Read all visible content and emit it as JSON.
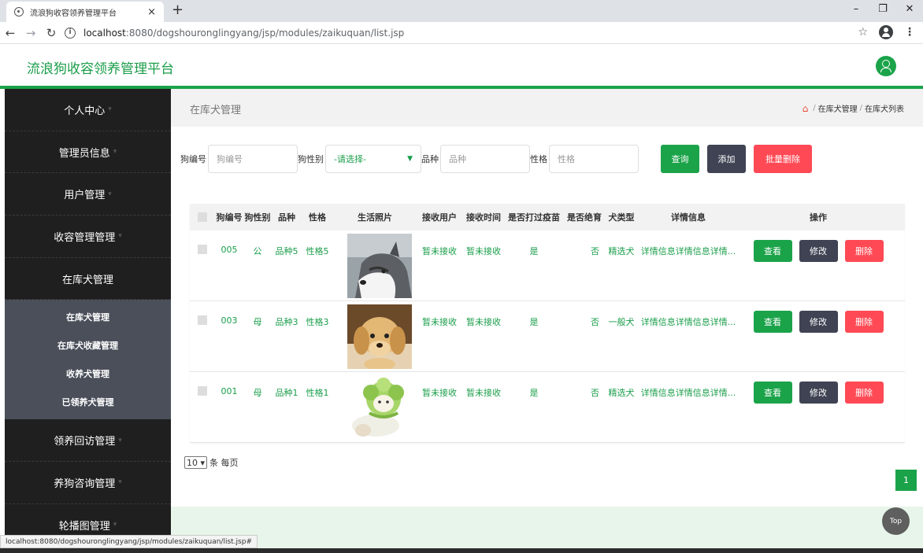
{
  "browser": {
    "tab_title": "流浪狗收容领养管理平台",
    "tab_close": "×",
    "new_tab": "+",
    "window_buttons": [
      "–",
      "❐",
      "✕"
    ],
    "url_host": "localhost",
    "url_path": ":8080/dogshouronglingyang/jsp/modules/zaikuquan/list.jsp",
    "status_url": "localhost:8080/dogshouronglingyang/jsp/modules/zaikuquan/list.jsp#"
  },
  "header": {
    "title": "流浪狗收容领养管理平台"
  },
  "sidebar": {
    "items": [
      {
        "label": "个人中心"
      },
      {
        "label": "管理员信息"
      },
      {
        "label": "用户管理"
      },
      {
        "label": "收容管理管理"
      },
      {
        "label": "在库犬管理"
      }
    ],
    "subitems": [
      {
        "label": "在库犬管理"
      },
      {
        "label": "在库犬收藏管理"
      },
      {
        "label": "收养犬管理"
      },
      {
        "label": "已领养犬管理"
      }
    ],
    "items_after": [
      {
        "label": "领养回访管理"
      },
      {
        "label": "养狗咨询管理"
      },
      {
        "label": "轮播图管理"
      }
    ]
  },
  "page": {
    "title": "在库犬管理",
    "breadcrumb": [
      "在库犬管理",
      "在库犬列表"
    ],
    "breadcrumb_sep": "/"
  },
  "search": {
    "dog_no_label": "狗编号",
    "dog_no_placeholder": "狗编号",
    "sex_label": "狗性别",
    "sex_value": "-请选择-",
    "breed_label": "品种",
    "breed_placeholder": "品种",
    "temper_label": "性格",
    "temper_placeholder": "性格",
    "query_button": "查询",
    "add_button": "添加",
    "batch_delete_button": "批量删除"
  },
  "table": {
    "columns": [
      "狗编号",
      "狗性别",
      "品种",
      "性格",
      "生活照片",
      "接收用户",
      "接收时间",
      "是否打过疫苗",
      "是否绝育",
      "犬类型",
      "详情信息",
      "操作"
    ],
    "rows": [
      {
        "no": "005",
        "sex": "公",
        "breed": "品种5",
        "temper": "性格5",
        "photo": "husky",
        "user": "暂未接收",
        "time": "暂未接收",
        "vaccinated": "是",
        "neutered": "否",
        "type": "精选犬",
        "detail": "详情信息详情信息详情..."
      },
      {
        "no": "003",
        "sex": "母",
        "breed": "品种3",
        "temper": "性格3",
        "photo": "puppy",
        "user": "暂未接收",
        "time": "暂未接收",
        "vaccinated": "是",
        "neutered": "否",
        "type": "一般犬",
        "detail": "详情信息详情信息详情..."
      },
      {
        "no": "001",
        "sex": "母",
        "breed": "品种1",
        "temper": "性格1",
        "photo": "cabbage-dog",
        "user": "暂未接收",
        "time": "暂未接收",
        "vaccinated": "是",
        "neutered": "否",
        "type": "精选犬",
        "detail": "详情信息详情信息详情..."
      }
    ],
    "actions": {
      "view": "查看",
      "edit": "修改",
      "delete": "删除"
    }
  },
  "pagination": {
    "page_size": "10",
    "per_page_label": "条 每页",
    "current_page": "1"
  },
  "top_button": "Top",
  "colors": {
    "accent": "#1ba34a",
    "dark_button": "#3f4353",
    "danger": "#ff4a55",
    "sidebar": "#1f1f1f",
    "submenu": "#4a4f5a"
  }
}
